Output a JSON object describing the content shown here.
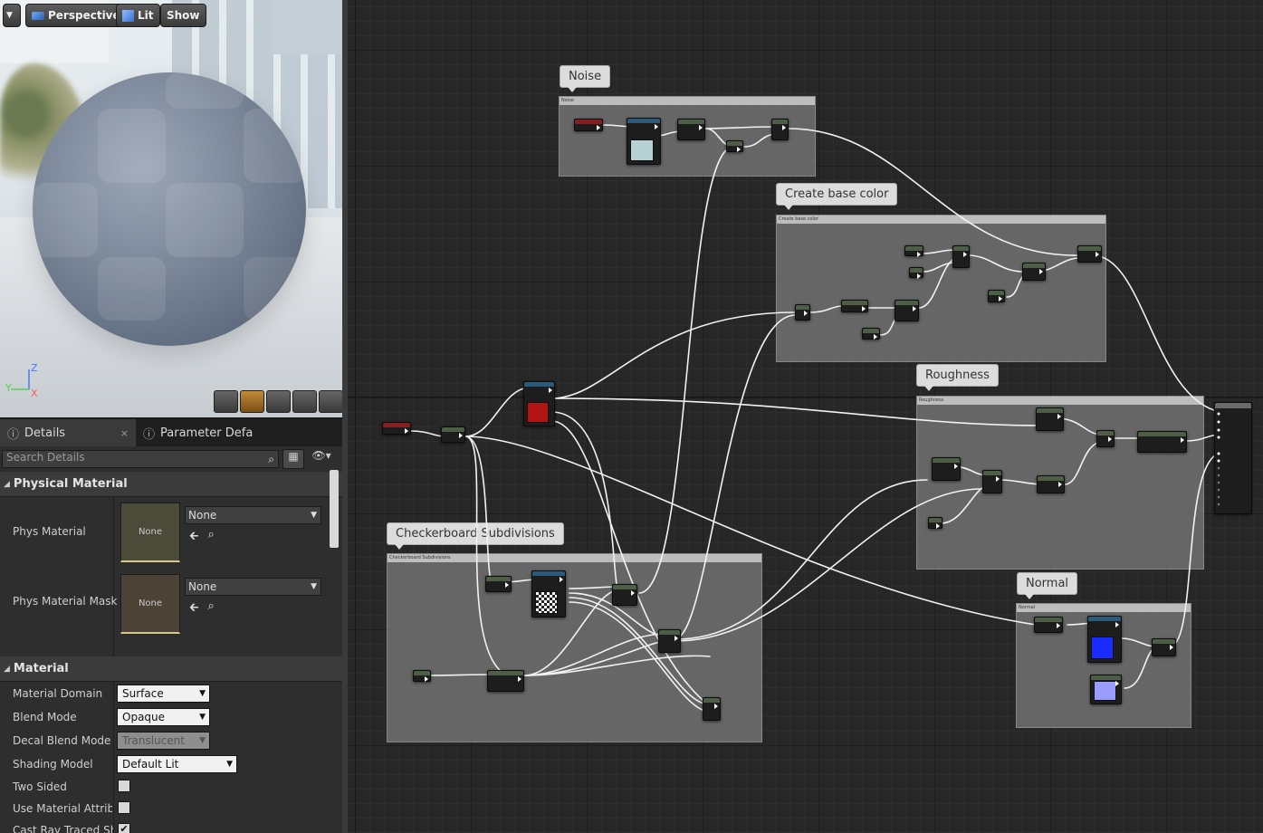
{
  "viewport": {
    "buttons": {
      "menu": "",
      "perspective": "Perspective",
      "lit": "Lit",
      "show": "Show"
    },
    "axes": {
      "x": "X",
      "y": "Y",
      "z": "Z"
    }
  },
  "details": {
    "tabs": [
      {
        "label": "Details",
        "close": "×"
      },
      {
        "label": "Parameter Defaults"
      }
    ],
    "search_placeholder": "Search Details",
    "physical_material": {
      "header": "Physical Material",
      "phys_material": {
        "label": "Phys Material",
        "thumb": "None",
        "value": "None"
      },
      "phys_material_mask": {
        "label": "Phys Material Mask",
        "thumb": "None",
        "value": "None"
      }
    },
    "material": {
      "header": "Material",
      "rows": [
        {
          "label": "Material Domain",
          "value": "Surface"
        },
        {
          "label": "Blend Mode",
          "value": "Opaque"
        },
        {
          "label": "Decal Blend Mode",
          "value": "Translucent"
        },
        {
          "label": "Shading Model",
          "value": "Default Lit"
        }
      ],
      "checks": [
        {
          "label": "Two Sided",
          "checked": false
        },
        {
          "label": "Use Material Attributes",
          "checked": false
        },
        {
          "label": "Cast Ray Traced Shadows",
          "checked": true,
          "mark": "✔"
        }
      ]
    }
  },
  "graph": {
    "comments": {
      "noise": "Noise",
      "base_color": "Create base color",
      "roughness": "Roughness",
      "checkerboard": "Checkerboard Subdivisions",
      "normal": "Normal"
    },
    "colors": {
      "red_param": "#b51414",
      "normal_blue": "#1a2cff",
      "normal_light": "#9a9cff",
      "wire": "#f2f2f2"
    }
  }
}
